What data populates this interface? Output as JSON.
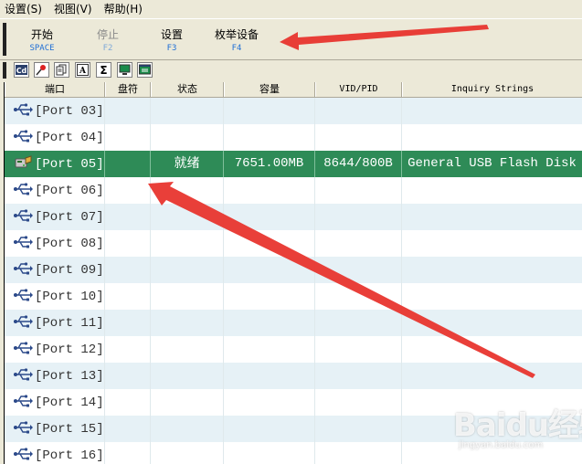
{
  "menu": [
    "设置(S)",
    "视图(V)",
    "帮助(H)"
  ],
  "big_toolbar": [
    {
      "label": "开始",
      "key": "SPACE",
      "enabled": true
    },
    {
      "label": "停止",
      "key": "F2",
      "enabled": false
    },
    {
      "label": "设置",
      "key": "F3",
      "enabled": true
    },
    {
      "label": "枚举设备",
      "key": "F4",
      "enabled": true
    }
  ],
  "small_toolbar_icons": [
    "cd-icon",
    "pin-icon",
    "copy-icon",
    "font-icon",
    "sigma-icon",
    "monitor-icon",
    "window-icon"
  ],
  "table": {
    "columns": [
      "端口",
      "盘符",
      "状态",
      "容量",
      "VID/PID",
      "Inquiry Strings"
    ],
    "rows": [
      {
        "port": "[Port 03]",
        "drive": "",
        "status": "",
        "capacity": "",
        "vidpid": "",
        "inquiry": ""
      },
      {
        "port": "[Port 04]",
        "drive": "",
        "status": "",
        "capacity": "",
        "vidpid": "",
        "inquiry": ""
      },
      {
        "port": "[Port 05]",
        "drive": "",
        "status": "就绪",
        "capacity": "7651.00MB",
        "vidpid": "8644/800B",
        "inquiry": "General USB Flash Disk",
        "selected": true
      },
      {
        "port": "[Port 06]",
        "drive": "",
        "status": "",
        "capacity": "",
        "vidpid": "",
        "inquiry": ""
      },
      {
        "port": "[Port 07]",
        "drive": "",
        "status": "",
        "capacity": "",
        "vidpid": "",
        "inquiry": ""
      },
      {
        "port": "[Port 08]",
        "drive": "",
        "status": "",
        "capacity": "",
        "vidpid": "",
        "inquiry": ""
      },
      {
        "port": "[Port 09]",
        "drive": "",
        "status": "",
        "capacity": "",
        "vidpid": "",
        "inquiry": ""
      },
      {
        "port": "[Port 10]",
        "drive": "",
        "status": "",
        "capacity": "",
        "vidpid": "",
        "inquiry": ""
      },
      {
        "port": "[Port 11]",
        "drive": "",
        "status": "",
        "capacity": "",
        "vidpid": "",
        "inquiry": ""
      },
      {
        "port": "[Port 12]",
        "drive": "",
        "status": "",
        "capacity": "",
        "vidpid": "",
        "inquiry": ""
      },
      {
        "port": "[Port 13]",
        "drive": "",
        "status": "",
        "capacity": "",
        "vidpid": "",
        "inquiry": ""
      },
      {
        "port": "[Port 14]",
        "drive": "",
        "status": "",
        "capacity": "",
        "vidpid": "",
        "inquiry": ""
      },
      {
        "port": "[Port 15]",
        "drive": "",
        "status": "",
        "capacity": "",
        "vidpid": "",
        "inquiry": ""
      },
      {
        "port": "[Port 16]",
        "drive": "",
        "status": "",
        "capacity": "",
        "vidpid": "",
        "inquiry": ""
      }
    ]
  },
  "watermark": {
    "main": "Baidu经验",
    "sub": "jingyan.baidu.com"
  },
  "colors": {
    "selected_row": "#2e8b57",
    "alt_row": "#e6f1f6",
    "arrow": "#e8352e",
    "key_text": "#1f6fd6"
  }
}
